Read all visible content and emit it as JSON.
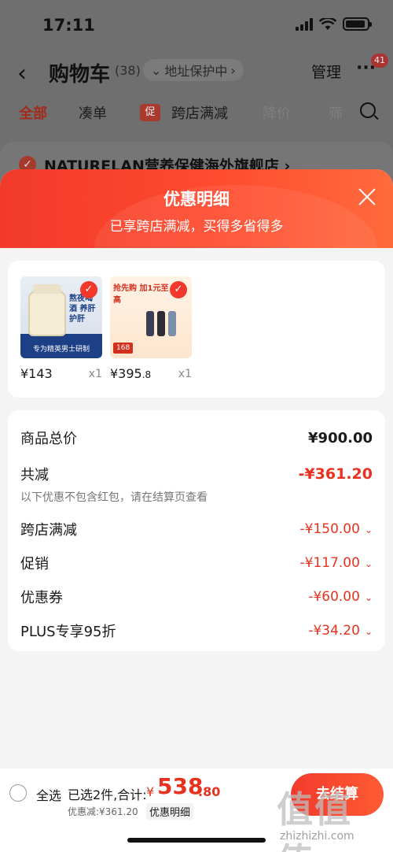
{
  "status_bar": {
    "time": "17:11"
  },
  "header": {
    "back_icon": "chevron-left-icon",
    "title": "购物车",
    "count": "(38)",
    "address_protect": "地址保护中",
    "manage": "管理",
    "more_badge": "41"
  },
  "tabs": [
    {
      "label": "全部"
    },
    {
      "label": "凑单"
    },
    {
      "label": "跨店满减",
      "badge": "促"
    },
    {
      "label": "降价"
    },
    {
      "label": "筛"
    }
  ],
  "shop": {
    "name": "NATURELAN营养保健海外旗舰店 ›"
  },
  "sheet": {
    "title": "优惠明细",
    "subtitle": "已享跨店满减，买得多省得多",
    "products": [
      {
        "price": "¥143",
        "qty": "x1",
        "img_text": "熬夜喝酒 养肝护肝",
        "img_band": "专为精英男士研制"
      },
      {
        "price_main": "¥395",
        "price_dec": ".8",
        "qty": "x1",
        "img_text": "抢先购 加1元至高",
        "img_tag": "168"
      }
    ],
    "rows": {
      "total_label": "商品总价",
      "total_value": "¥900.00",
      "reduce_label": "共减",
      "reduce_value": "-¥361.20",
      "note": "以下优惠不包含红包，请在结算页查看",
      "items": [
        {
          "label": "跨店满减",
          "value": "-¥150.00"
        },
        {
          "label": "促销",
          "value": "-¥117.00"
        },
        {
          "label": "优惠券",
          "value": "-¥60.00"
        },
        {
          "label": "PLUS专享95折",
          "value": "-¥34.20"
        }
      ]
    }
  },
  "bottom": {
    "select_all": "全选",
    "summary": "已选2件,合计:",
    "currency": "¥",
    "total_main": "538",
    "total_dec": ".80",
    "discount": "优惠减:¥361.20",
    "detail_link": "优惠明细",
    "checkout": "去结算"
  },
  "watermark": {
    "logo": "值值值",
    "url": "zhizhizhi.com"
  },
  "colors": {
    "accent": "#e8321f",
    "sheet_header": "#f13a2a"
  }
}
